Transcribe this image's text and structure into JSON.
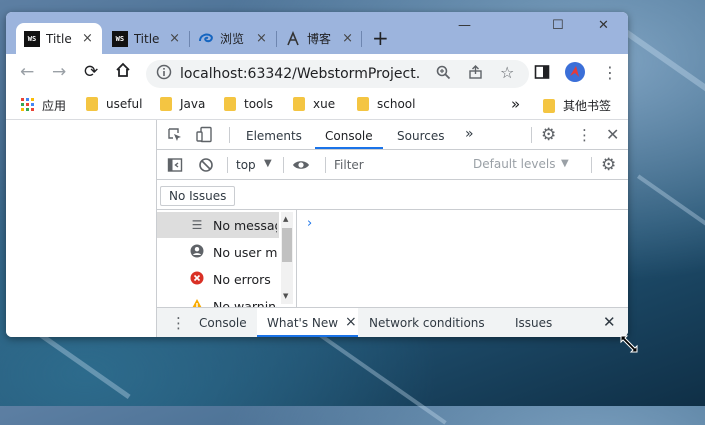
{
  "colors": {
    "accent": "#1a73e8",
    "titlebar": "#9cb4dd",
    "error": "#d93025",
    "warning": "#f9ab00",
    "folder": "#f4c542"
  },
  "tabs": [
    {
      "title": "Title",
      "icon": "webstorm-icon",
      "icon_text": "WS",
      "close": "×"
    },
    {
      "title": "Title",
      "icon": "webstorm-icon",
      "icon_text": "WS",
      "close": "×"
    },
    {
      "title": "浏览",
      "icon": "edge-swirl-icon",
      "close": "×"
    },
    {
      "title": "博客",
      "icon": "blog-icon",
      "close": "×"
    }
  ],
  "new_tab": "+",
  "window_controls": {
    "minimize": "—",
    "maximize": "☐",
    "close": "✕"
  },
  "toolbar": {
    "url": "localhost:63342/WebstormProject..."
  },
  "bookmarks": {
    "apps_label": "应用",
    "items": [
      "useful",
      "Java",
      "tools",
      "xue",
      "school"
    ],
    "more": "»",
    "other": "其他书签"
  },
  "devtools": {
    "tabs": [
      "Elements",
      "Console",
      "Sources"
    ],
    "more_tabs": "»",
    "console_bar": {
      "context": "top",
      "filter_placeholder": "Filter",
      "levels": "Default levels"
    },
    "issues_button": "No Issues",
    "sidebar": [
      {
        "label": "No messages",
        "icon": "list-icon"
      },
      {
        "label": "No user messages",
        "icon": "user-icon"
      },
      {
        "label": "No errors",
        "icon": "error-icon"
      },
      {
        "label": "No warnings",
        "icon": "warning-icon"
      }
    ],
    "prompt": "›",
    "drawer": {
      "tabs": [
        "Console",
        "What's New",
        "Network conditions",
        "Issues"
      ],
      "active": "What's New",
      "close_active": "×",
      "close_drawer": "✕"
    }
  }
}
